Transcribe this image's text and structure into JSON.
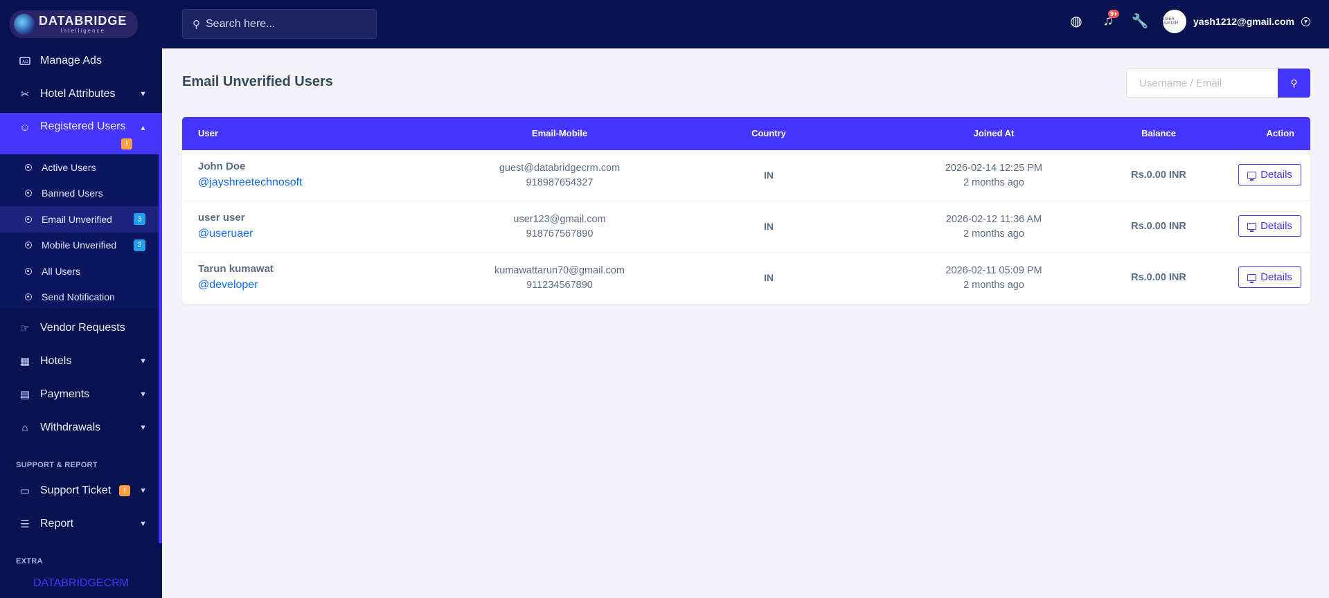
{
  "brand": {
    "name": "DATABRIDGE",
    "tagline": "Intelligence"
  },
  "sidebar": {
    "items": [
      {
        "label": "Manage Ads",
        "icon": "ad-icon"
      },
      {
        "label": "Hotel Attributes",
        "icon": "tools-icon",
        "has_children": true
      },
      {
        "label": "Registered Users",
        "icon": "users-icon",
        "has_children": true,
        "expanded": true,
        "badge": "!"
      },
      {
        "label": "Vendor Requests",
        "icon": "hand-point-icon"
      },
      {
        "label": "Hotels",
        "icon": "building-icon",
        "has_children": true
      },
      {
        "label": "Payments",
        "icon": "receipt-icon",
        "has_children": true
      },
      {
        "label": "Withdrawals",
        "icon": "bank-icon",
        "has_children": true
      },
      {
        "label": "Support Ticket",
        "icon": "ticket-icon",
        "has_children": true,
        "badge": "!"
      },
      {
        "label": "Report",
        "icon": "list-icon",
        "has_children": true
      }
    ],
    "submenu": [
      {
        "label": "Active Users"
      },
      {
        "label": "Banned Users"
      },
      {
        "label": "Email Unverified",
        "badge": "3",
        "current": true
      },
      {
        "label": "Mobile Unverified",
        "badge": "3"
      },
      {
        "label": "All Users"
      },
      {
        "label": "Send Notification"
      }
    ],
    "sections": {
      "support": "SUPPORT & REPORT",
      "extra": "EXTRA"
    },
    "footer_brand": "DATABRIDGECRM"
  },
  "topbar": {
    "search_placeholder": "Search here...",
    "notification_badge": "9+",
    "user_email": "yash1212@gmail.com",
    "avatar_text": "USER AVATAR"
  },
  "page": {
    "title": "Email Unverified Users",
    "filter_placeholder": "Username / Email"
  },
  "table": {
    "columns": [
      "User",
      "Email-Mobile",
      "Country",
      "Joined At",
      "Balance",
      "Action"
    ],
    "rows": [
      {
        "name": "John Doe",
        "username": "@jayshreetechnosoft",
        "email": "guest@databridgecrm.com",
        "mobile": "918987654327",
        "country": "IN",
        "joined": "2026-02-14 12:25 PM",
        "joined_ago": "2 months ago",
        "balance": "Rs.0.00 INR",
        "action": "Details"
      },
      {
        "name": "user user",
        "username": "@useruaer",
        "email": "user123@gmail.com",
        "mobile": "918767567890",
        "country": "IN",
        "joined": "2026-02-12 11:36 AM",
        "joined_ago": "2 months ago",
        "balance": "Rs.0.00 INR",
        "action": "Details"
      },
      {
        "name": "Tarun kumawat",
        "username": "@developer",
        "email": "kumawattarun70@gmail.com",
        "mobile": "911234567890",
        "country": "IN",
        "joined": "2026-02-11 05:09 PM",
        "joined_ago": "2 months ago",
        "balance": "Rs.0.00 INR",
        "action": "Details"
      }
    ]
  },
  "colors": {
    "sidebar_bg": "#071251",
    "accent": "#4634ff",
    "link": "#0d6efd",
    "warning": "#ff9f43",
    "info": "#1e9ff2",
    "danger": "#ea5455"
  }
}
